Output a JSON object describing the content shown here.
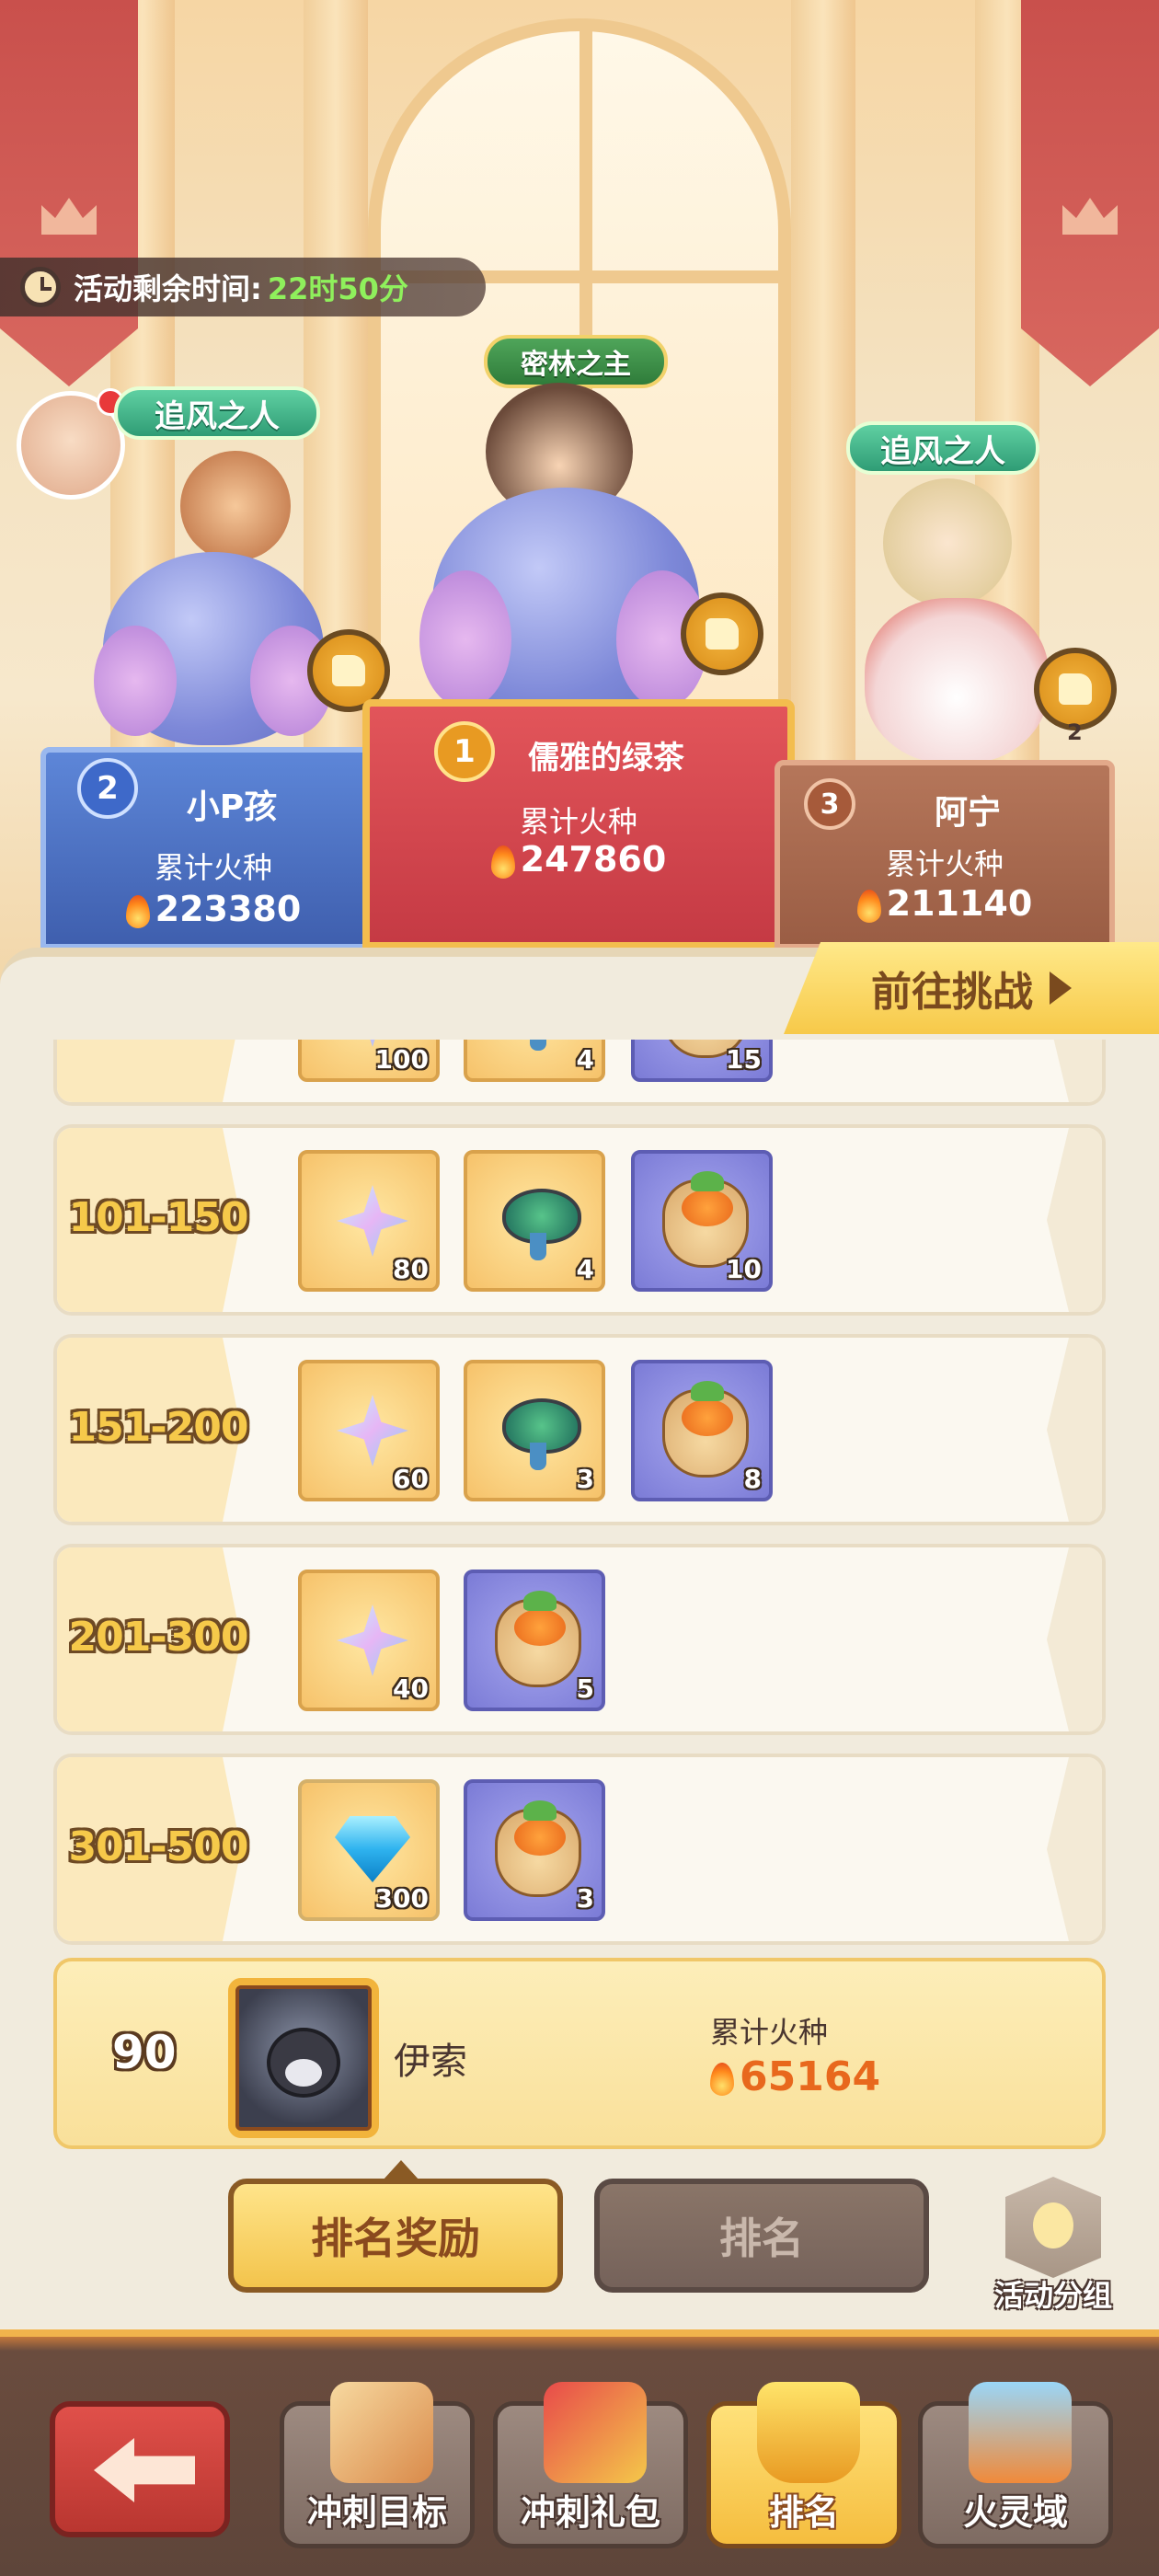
{
  "event": {
    "timer_label": "活动剩余时间:",
    "timer_value": "22时50分"
  },
  "podium": [
    {
      "rank": "2",
      "name": "小P孩",
      "title": "追风之人",
      "score_label": "累计火种",
      "score": "223380",
      "likes": ""
    },
    {
      "rank": "1",
      "name": "儒雅的绿茶",
      "title": "密林之主",
      "score_label": "累计火种",
      "score": "247860",
      "likes": ""
    },
    {
      "rank": "3",
      "name": "阿宁",
      "title": "追风之人",
      "score_label": "累计火种",
      "score": "211140",
      "likes": "2"
    }
  ],
  "challenge_button": "前往挑战",
  "reward_rows": [
    {
      "range": "",
      "items": [
        {
          "icon": "star-crystal-icon",
          "count": "100"
        },
        {
          "icon": "spinning-top-icon",
          "count": "4"
        },
        {
          "icon": "carrot-sack-icon",
          "count": "15"
        }
      ]
    },
    {
      "range": "101-150",
      "items": [
        {
          "icon": "star-crystal-icon",
          "count": "80"
        },
        {
          "icon": "spinning-top-icon",
          "count": "4"
        },
        {
          "icon": "carrot-sack-icon",
          "count": "10"
        }
      ]
    },
    {
      "range": "151-200",
      "items": [
        {
          "icon": "star-crystal-icon",
          "count": "60"
        },
        {
          "icon": "spinning-top-icon",
          "count": "3"
        },
        {
          "icon": "carrot-sack-icon",
          "count": "8"
        }
      ]
    },
    {
      "range": "201-300",
      "items": [
        {
          "icon": "star-crystal-icon",
          "count": "40"
        },
        {
          "icon": "carrot-sack-icon",
          "count": "5"
        }
      ]
    },
    {
      "range": "301-500",
      "items": [
        {
          "icon": "diamond-icon",
          "count": "300"
        },
        {
          "icon": "carrot-sack-icon",
          "count": "3"
        }
      ]
    }
  ],
  "my_rank": {
    "rank": "90",
    "name": "伊索",
    "score_label": "累计火种",
    "score": "65164"
  },
  "tabs": {
    "reward": "排名奖励",
    "rank": "排名",
    "group": "活动分组"
  },
  "nav": [
    {
      "label": "冲刺目标",
      "icon": "scroll-icon"
    },
    {
      "label": "冲刺礼包",
      "icon": "gift-pack-icon"
    },
    {
      "label": "排名",
      "icon": "trophy-icon"
    },
    {
      "label": "火灵域",
      "icon": "sword-shield-icon"
    }
  ],
  "colors": {
    "accent": "#f5c44a",
    "score_orange": "#e8681d",
    "timer_green": "#8ff05c"
  }
}
